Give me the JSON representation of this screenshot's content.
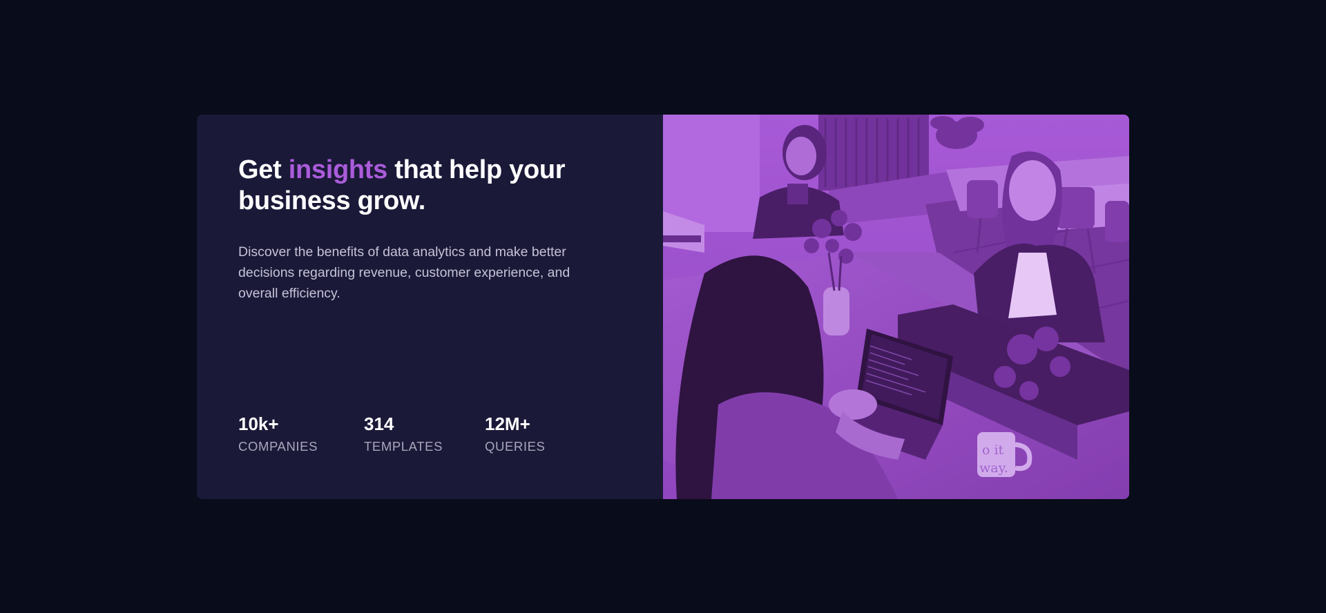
{
  "hero": {
    "title_before": "Get ",
    "title_accent": "insights",
    "title_after": " that help your business grow.",
    "description": "Discover the benefits of data analytics and make better decisions regarding revenue, customer experience, and overall efficiency.",
    "image_alt": "Colleagues working together at a table with laptops"
  },
  "stats": [
    {
      "value": "10k+",
      "label": "COMPANIES"
    },
    {
      "value": "314",
      "label": "TEMPLATES"
    },
    {
      "value": "12M+",
      "label": "QUERIES"
    }
  ],
  "colors": {
    "page_background": "#090c1a",
    "card_background": "#1b1938",
    "accent": "#aa5cdb",
    "image_overlay": "#aa5cdb"
  },
  "mug": {
    "text_line1": "o it",
    "text_line2": "way."
  }
}
